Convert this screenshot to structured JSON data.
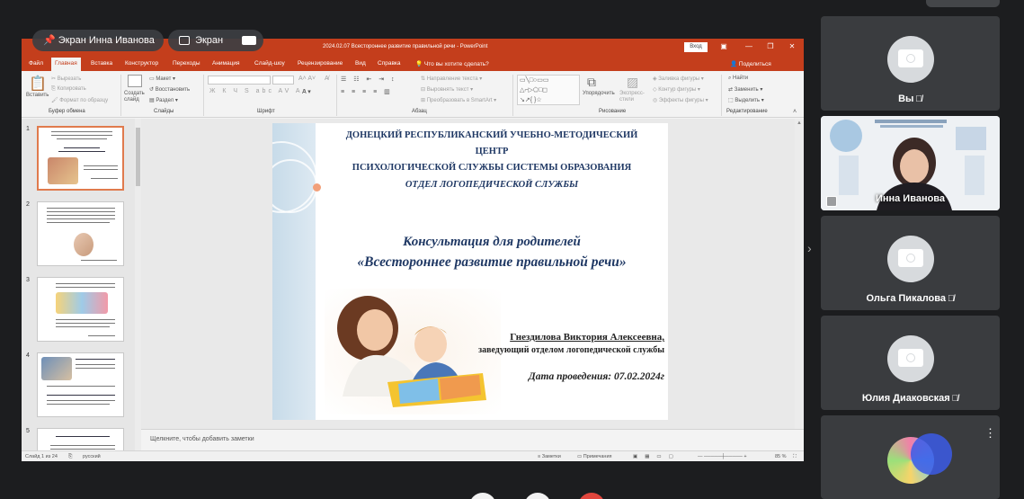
{
  "meeting": {
    "screen_owner": "Экран Инна Иванова",
    "screen_label": "Экран",
    "participants": [
      {
        "name": "Вы",
        "muted": true
      },
      {
        "name": "Инна Иванова",
        "muted": false
      },
      {
        "name": "Ольга Пикалова",
        "muted": true
      },
      {
        "name": "Юлия Диаковская",
        "muted": true
      }
    ],
    "expand_chevron": "›",
    "more_icon": "⋮"
  },
  "ppt": {
    "title": "2024.02.07 Всестороннее развитие правильной речи  -  PowerPoint",
    "signin": "Вход",
    "window_controls": [
      "▣",
      "—",
      "❐",
      "✕"
    ],
    "tabs": [
      "Файл",
      "Главная",
      "Вставка",
      "Конструктор",
      "Переходы",
      "Анимация",
      "Слайд-шоу",
      "Рецензирование",
      "Вид",
      "Справка",
      "Что вы хотите сделать?"
    ],
    "active_tab": "Главная",
    "share": "Поделиться",
    "ribbon": {
      "paste": "Вставить",
      "cut": "Вырезать",
      "copy": "Копировать",
      "format_painter": "Формат по образцу",
      "clipboard": "Буфер обмена",
      "new_slide": "Создать слайд",
      "layout": "Макет",
      "reset": "Восстановить",
      "section": "Раздел",
      "slides": "Слайды",
      "font": "Шрифт",
      "text_direction": "Направление текста",
      "align_text": "Выровнять текст",
      "smartart": "Преобразовать в SmartArt",
      "paragraph": "Абзац",
      "arrange": "Упорядочить",
      "quick_styles": "Экспресс-стили",
      "fill": "Заливка фигуры",
      "outline": "Контур фигуры",
      "effects": "Эффекты фигуры",
      "drawing": "Рисование",
      "find": "Найти",
      "replace": "Заменить",
      "select": "Выделить",
      "editing": "Редактирование"
    },
    "thumbnail_numbers": [
      "1",
      "2",
      "3",
      "4",
      "5"
    ],
    "slide": {
      "org_lines": [
        "ДОНЕЦКИЙ РЕСПУБЛИКАНСКИЙ УЧЕБНО-МЕТОДИЧЕСКИЙ",
        "ЦЕНТР",
        "ПСИХОЛОГИЧЕСКОЙ СЛУЖБЫ СИСТЕМЫ ОБРАЗОВАНИЯ",
        "ОТДЕЛ ЛОГОПЕДИЧЕСКОЙ СЛУЖБЫ"
      ],
      "consult": "Консультация для родителей",
      "topic": "«Всестороннее развитие правильной речи»",
      "author": "Гнездилова Виктория Алексеевна,",
      "position": "заведующий отделом логопедической службы",
      "date": "Дата проведения:    07.02.2024г"
    },
    "notes_placeholder": "Щелкните, чтобы добавить заметки",
    "status": {
      "slide": "Слайд 1 из 24",
      "lang": "русский",
      "notes": "Заметки",
      "comments": "Примечания",
      "zoom": "85 %"
    }
  }
}
